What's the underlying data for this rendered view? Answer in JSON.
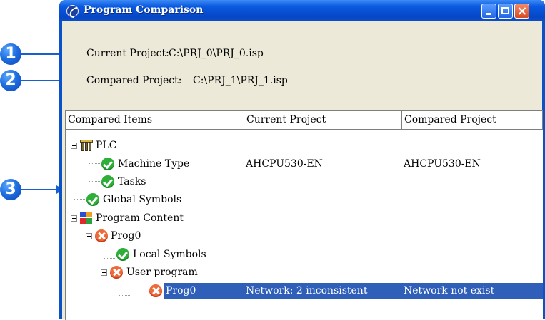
{
  "window": {
    "title": "Program Comparison"
  },
  "callouts": [
    "1",
    "2",
    "3"
  ],
  "info": {
    "current_label": "Current Project:",
    "current_value": "C:\\PRJ_0\\PRJ_0.isp",
    "compared_label": "Compared Project:",
    "compared_value": "C:\\PRJ_1\\PRJ_1.isp"
  },
  "columns": [
    "Compared Items",
    "Current Project",
    "Compared Project"
  ],
  "tree": [
    {
      "label": "PLC",
      "icon": "plc-icon",
      "current": "",
      "compared": ""
    },
    {
      "label": "Machine Type",
      "icon": "ok-icon",
      "current": "AHCPU530-EN",
      "compared": "AHCPU530-EN"
    },
    {
      "label": "Tasks",
      "icon": "ok-icon",
      "current": "",
      "compared": ""
    },
    {
      "label": "Global Symbols",
      "icon": "ok-icon",
      "current": "",
      "compared": ""
    },
    {
      "label": "Program Content",
      "icon": "program-content-icon",
      "current": "",
      "compared": ""
    },
    {
      "label": "Prog0",
      "icon": "error-icon",
      "current": "",
      "compared": ""
    },
    {
      "label": "Local Symbols",
      "icon": "ok-icon",
      "current": "",
      "compared": ""
    },
    {
      "label": "User program",
      "icon": "error-icon",
      "current": "",
      "compared": ""
    },
    {
      "label": "Prog0",
      "icon": "error-icon",
      "current": "Network: 2 inconsistent",
      "compared": "Network not exist",
      "selected": true
    }
  ],
  "colors": {
    "title_bar": "#0a52c8",
    "selection": "#2f5fb8",
    "ok": "#2fae3a",
    "error": "#ef6a3a",
    "callout": "#1f6fe0"
  }
}
